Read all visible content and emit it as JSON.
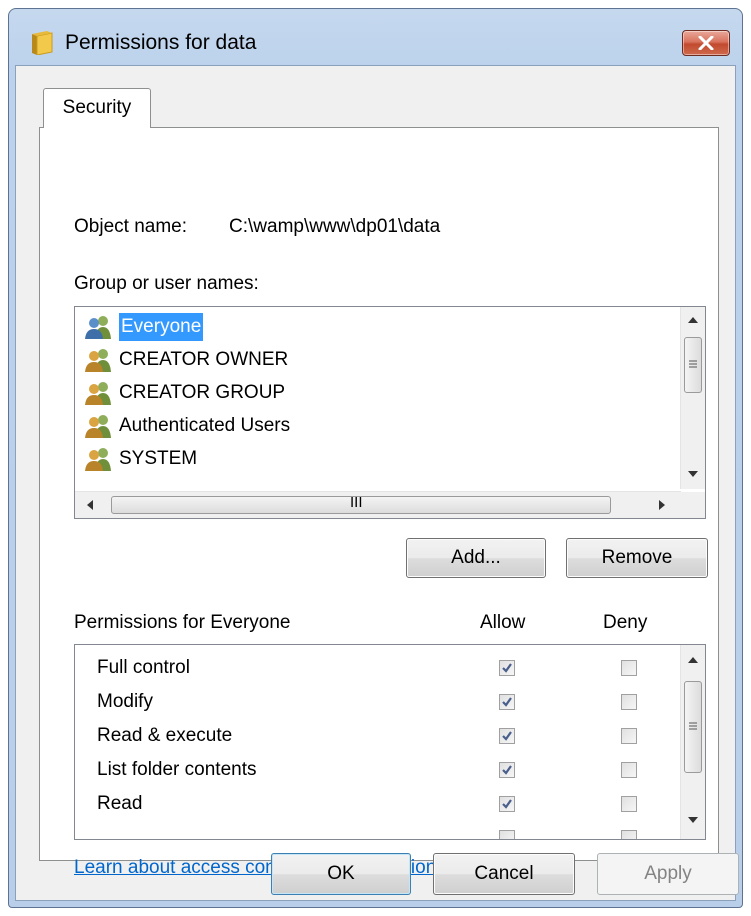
{
  "window": {
    "title": "Permissions for data",
    "icon": "folder-icon",
    "close_icon": "close-icon"
  },
  "tabs": [
    {
      "label": "Security",
      "selected": true
    }
  ],
  "object": {
    "label": "Object name:",
    "value": "C:\\wamp\\www\\dp01\\data"
  },
  "groups": {
    "label": "Group or user names:",
    "selected_index": 0,
    "items": [
      {
        "label": "Everyone",
        "icon": "users-icon"
      },
      {
        "label": "CREATOR OWNER",
        "icon": "users-icon"
      },
      {
        "label": "CREATOR GROUP",
        "icon": "users-icon"
      },
      {
        "label": "Authenticated Users",
        "icon": "users-icon"
      },
      {
        "label": "SYSTEM",
        "icon": "users-icon"
      }
    ],
    "hscroll_grip": "III"
  },
  "buttons": {
    "add": "Add...",
    "remove": "Remove",
    "ok": "OK",
    "cancel": "Cancel",
    "apply": "Apply"
  },
  "permissions": {
    "header": "Permissions for Everyone",
    "allow_header": "Allow",
    "deny_header": "Deny",
    "rows": [
      {
        "label": "Full control",
        "allow": true,
        "deny": false
      },
      {
        "label": "Modify",
        "allow": true,
        "deny": false
      },
      {
        "label": "Read & execute",
        "allow": true,
        "deny": false
      },
      {
        "label": "List folder contents",
        "allow": true,
        "deny": false
      },
      {
        "label": "Read",
        "allow": true,
        "deny": false
      }
    ]
  },
  "help_link": "Learn about access control and permissions",
  "colors": {
    "selection": "#3399ff",
    "link": "#0066cc",
    "close_button": "#c7503a"
  }
}
